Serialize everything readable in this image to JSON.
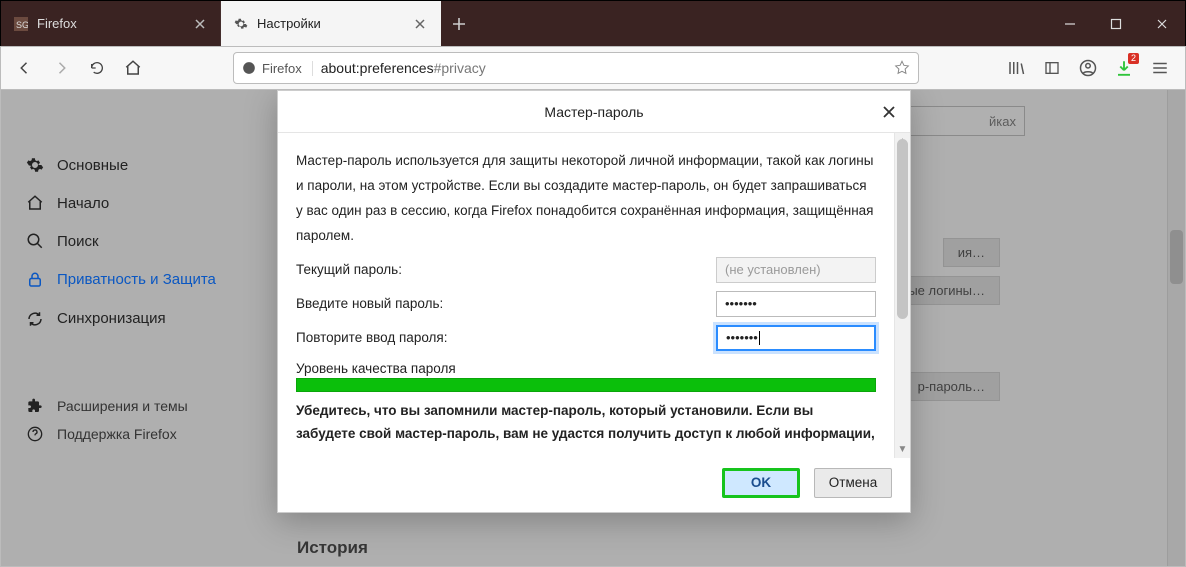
{
  "window": {
    "tabs": [
      {
        "label": "Firefox",
        "active": false
      },
      {
        "label": "Настройки",
        "active": true
      }
    ]
  },
  "navbar": {
    "identity": "Firefox",
    "url_prefix": "about:preferences",
    "url_hash": "#privacy"
  },
  "toolbar_badge": "2",
  "bg": {
    "search_suffix": "йках",
    "btn1": "ия…",
    "btn2": "ые логины…",
    "btn3": "р-пароль…",
    "history": "История"
  },
  "sidebar": {
    "items": [
      {
        "label": "Основные"
      },
      {
        "label": "Начало"
      },
      {
        "label": "Поиск"
      },
      {
        "label": "Приватность и Защита"
      },
      {
        "label": "Синхронизация"
      }
    ],
    "footer": [
      {
        "label": "Расширения и темы"
      },
      {
        "label": "Поддержка Firefox"
      }
    ]
  },
  "dialog": {
    "title": "Мастер-пароль",
    "description": "Мастер-пароль используется для защиты некоторой личной информации, такой как логины и пароли, на этом устройстве. Если вы создадите мастер-пароль, он будет запрашиваться у вас один раз в сессию, когда Firefox понадобится сохранённая информация, защищённая паролем.",
    "current_label": "Текущий пароль:",
    "current_placeholder": "(не установлен)",
    "new_label": "Введите новый пароль:",
    "new_value": "•••••••",
    "repeat_label": "Повторите ввод пароля:",
    "repeat_value": "•••••••",
    "quality_label": "Уровень качества пароля",
    "warning": "Убедитесь, что вы запомнили мастер-пароль, который установили. Если вы забудете свой мастер-пароль, вам не удастся получить доступ к любой информации,",
    "ok": "OK",
    "cancel": "Отмена"
  }
}
